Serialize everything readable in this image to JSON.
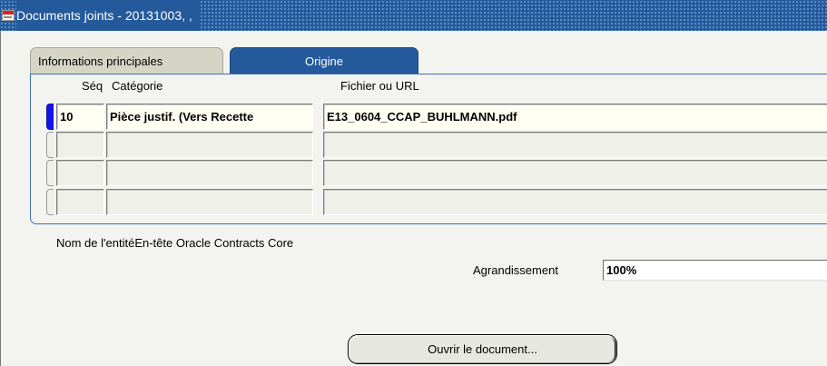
{
  "window": {
    "title": "Documents joints - 20131003, ,"
  },
  "tabs": [
    {
      "label": "Informations principales",
      "active": false
    },
    {
      "label": "Origine",
      "active": true
    }
  ],
  "table": {
    "columns": [
      "Séq",
      "Catégorie",
      "Fichier ou URL"
    ],
    "rows": [
      {
        "seq": "10",
        "category": "Pièce justif. (Vers Recette",
        "file": "E13_0604_CCAP_BUHLMANN.pdf",
        "current": true
      },
      {
        "seq": "",
        "category": "",
        "file": "",
        "current": false
      },
      {
        "seq": "",
        "category": "",
        "file": "",
        "current": false
      },
      {
        "seq": "",
        "category": "",
        "file": "",
        "current": false
      }
    ]
  },
  "entity": {
    "label": "Nom de l'entité",
    "value": "En-tête Oracle Contracts Core"
  },
  "zoom": {
    "label": "Agrandissement",
    "value": "100%"
  },
  "buttons": {
    "open_document": "Ouvrir le document..."
  },
  "colors": {
    "title_bar": "#245a9c",
    "active_tab": "#245a9c",
    "inactive_tab": "#d5d5c6",
    "record_indicator": "#1414ee"
  }
}
